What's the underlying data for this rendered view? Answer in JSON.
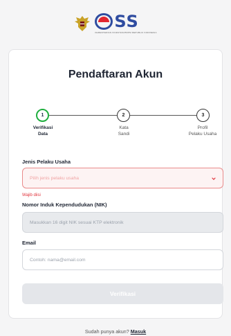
{
  "brand": {
    "name": "OSS",
    "tagline": "KEMENTERIAN INVESTASI/BKPM REPUBLIK INDONESIA"
  },
  "form": {
    "title": "Pendaftaran Akun",
    "steps": [
      {
        "number": "1",
        "label_line1": "Verifikasi",
        "label_line2": "Data",
        "active": true
      },
      {
        "number": "2",
        "label_line1": "Kata",
        "label_line2": "Sandi",
        "active": false
      },
      {
        "number": "3",
        "label_line1": "Profil",
        "label_line2": "Pelaku Usaha",
        "active": false
      }
    ],
    "business_type": {
      "label": "Jenis Pelaku Usaha",
      "placeholder": "Pilih jenis pelaku usaha",
      "error": "Wajib diisi"
    },
    "nik": {
      "label": "Nomor Induk Kependudukan (NIK)",
      "placeholder": "Masukkan 16 digit NIK sesuai KTP elektronik"
    },
    "email": {
      "label": "Email",
      "placeholder": "Contoh: nama@email.com"
    },
    "submit_label": "Verifikasi"
  },
  "footer": {
    "question": "Sudah punya akun?",
    "login_link": "Masuk"
  },
  "colors": {
    "accent_green": "#1fae3f",
    "brand_blue": "#2f4ca0",
    "error_red": "#e0313a"
  }
}
